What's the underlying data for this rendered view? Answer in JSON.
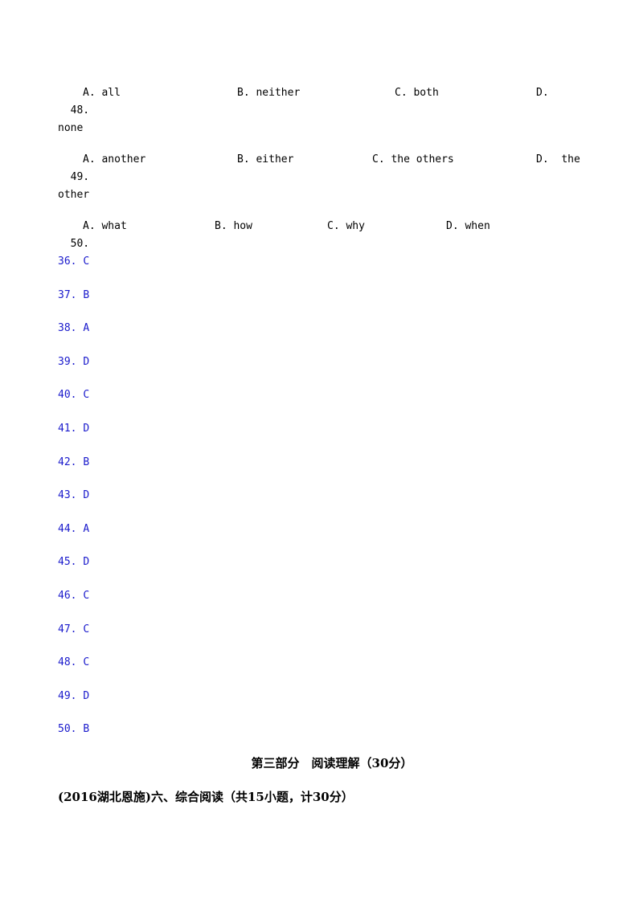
{
  "questions": [
    {
      "number": "48.",
      "options": [
        {
          "letter": "A.",
          "text": "all"
        },
        {
          "letter": "B.",
          "text": "neither"
        },
        {
          "letter": "C.",
          "text": "both"
        },
        {
          "letter": "D.",
          "text": ""
        }
      ],
      "wrap": "none"
    },
    {
      "number": "49.",
      "options": [
        {
          "letter": "A.",
          "text": "another"
        },
        {
          "letter": "B.",
          "text": "either"
        },
        {
          "letter": "C.",
          "text": "the others"
        },
        {
          "letter": "D.",
          "text": "the"
        }
      ],
      "wrap": "other"
    },
    {
      "number": "50.",
      "options": [
        {
          "letter": "A.",
          "text": "what"
        },
        {
          "letter": "B.",
          "text": "how"
        },
        {
          "letter": "C.",
          "text": "why"
        },
        {
          "letter": "D.",
          "text": "when"
        }
      ],
      "wrap": ""
    }
  ],
  "answers": [
    {
      "number": "36.",
      "answer": "C"
    },
    {
      "number": "37.",
      "answer": "B"
    },
    {
      "number": "38.",
      "answer": "A"
    },
    {
      "number": "39.",
      "answer": "D"
    },
    {
      "number": "40.",
      "answer": "C"
    },
    {
      "number": "41.",
      "answer": "D"
    },
    {
      "number": "42.",
      "answer": "B"
    },
    {
      "number": "43.",
      "answer": "D"
    },
    {
      "number": "44.",
      "answer": "A"
    },
    {
      "number": "45.",
      "answer": "D"
    },
    {
      "number": "46.",
      "answer": "C"
    },
    {
      "number": "47.",
      "answer": "C"
    },
    {
      "number": "48.",
      "answer": "C"
    },
    {
      "number": "49.",
      "answer": "D"
    },
    {
      "number": "50.",
      "answer": "B"
    }
  ],
  "section_title": "第三部分　阅读理解（30分）",
  "section_subtitle": "(2016湖北恩施)六、综合阅读（共15小题，计30分）",
  "colors": {
    "answer_text": "#1a1acc",
    "body_text": "#000000"
  }
}
